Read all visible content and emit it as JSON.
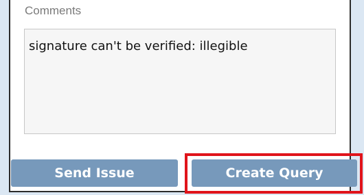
{
  "comments": {
    "label": "Comments",
    "value": "signature can't be verified: illegible"
  },
  "actions": {
    "send_issue_label": "Send Issue",
    "create_query_label": "Create Query"
  },
  "colors": {
    "background": "#dbe7f3",
    "button": "#7799bb",
    "highlight": "#e0141b"
  }
}
